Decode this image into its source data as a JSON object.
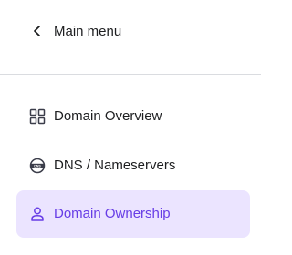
{
  "main_menu": {
    "label": "Main menu",
    "icon": "chevron-left-icon"
  },
  "nav": {
    "items": [
      {
        "label": "Domain Overview",
        "icon": "grid-icon",
        "active": false
      },
      {
        "label": "DNS / Nameservers",
        "icon": "dns-icon",
        "active": false
      },
      {
        "label": "Domain Ownership",
        "icon": "user-icon",
        "active": true
      }
    ]
  },
  "colors": {
    "accent": "#673de6",
    "active_bg": "#ebe4ff",
    "text": "#1d1e20",
    "divider": "#dadce0"
  }
}
